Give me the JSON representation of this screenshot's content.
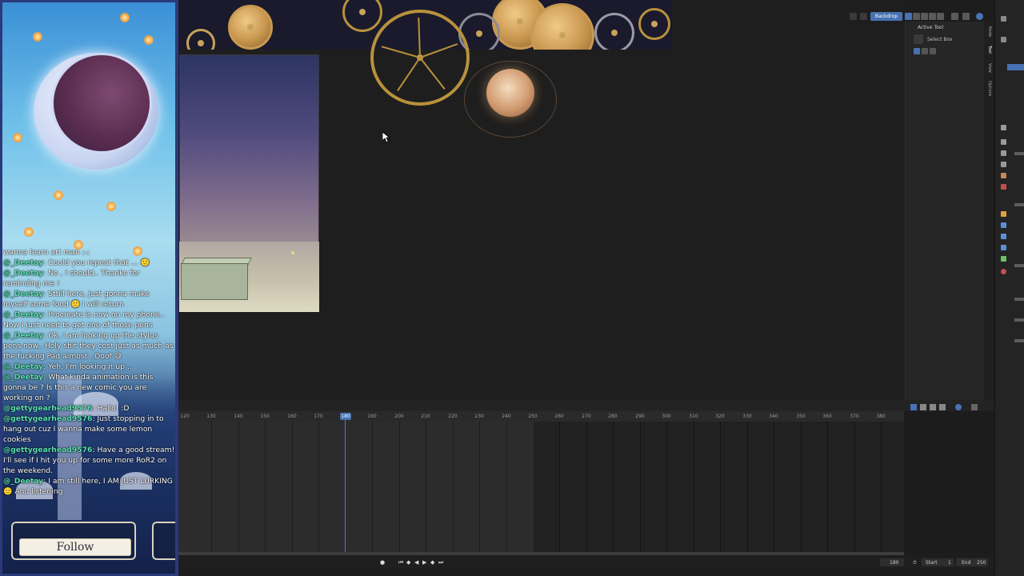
{
  "stream_overlay": {
    "chat": [
      {
        "user": "",
        "text": "wanna learn art man ;-;"
      },
      {
        "user": "@_Deetay",
        "text": "Could you repeat that … 🙂"
      },
      {
        "user": "@_Deetay",
        "text": "No , I should.. Thanks for reminding me !"
      },
      {
        "user": "@_Deetay",
        "text": "Sttill here, just gonna make myself some food 🙂 I will return"
      },
      {
        "user": "@_Deetay",
        "text": "Procreate is now on my phone.. Now I just need to get one of those pens"
      },
      {
        "user": "@_Deetay",
        "text": "Ok, I am looking up the stylus pens now.. Holy shit they cost just as much as the fucking Pad almost ..Ooof 😅"
      },
      {
        "user": "@_Deetay",
        "text": "Yeh, I'm looking it up .."
      },
      {
        "user": "@_Deetay",
        "text": "What kinda animation is this gonna be ? Is this a new comic you are working on ?"
      },
      {
        "user": "@gettygearhead9576",
        "text": "Hallo! :D"
      },
      {
        "user": "@gettygearhead9576",
        "text": "Just stopping in to hang out cuz I wanna make some lemon cookies"
      },
      {
        "user": "@gettygearhead9576",
        "text": "Have a good stream! I'll see if I hit you up for some more RoR2 on the weekend."
      },
      {
        "user": "@_Deetay",
        "text": "I am still here, I AM JUST LURKING 🙂 And listening"
      }
    ],
    "follow_label": "Follow"
  },
  "blender": {
    "header": {
      "backdrop_label": "Backdrop"
    },
    "sidebar": {
      "active_tool_heading": "Active Tool",
      "select_box_label": "Select Box",
      "tabs": [
        "Node",
        "Tool",
        "View",
        "Options"
      ]
    },
    "timeline": {
      "ticks": [
        "120",
        "130",
        "140",
        "150",
        "160",
        "170",
        "180",
        "190",
        "200",
        "210",
        "220",
        "230",
        "240",
        "250",
        "260",
        "270",
        "280",
        "290",
        "300",
        "310",
        "320",
        "330",
        "340",
        "350",
        "360",
        "370",
        "380"
      ],
      "current_frame": "180",
      "frame_field": "180",
      "start_label": "Start",
      "start_value": "1",
      "end_label": "End",
      "end_value": "250"
    },
    "colors": {
      "accent": "#4772b3",
      "chat_user": "#5be0b2"
    }
  }
}
